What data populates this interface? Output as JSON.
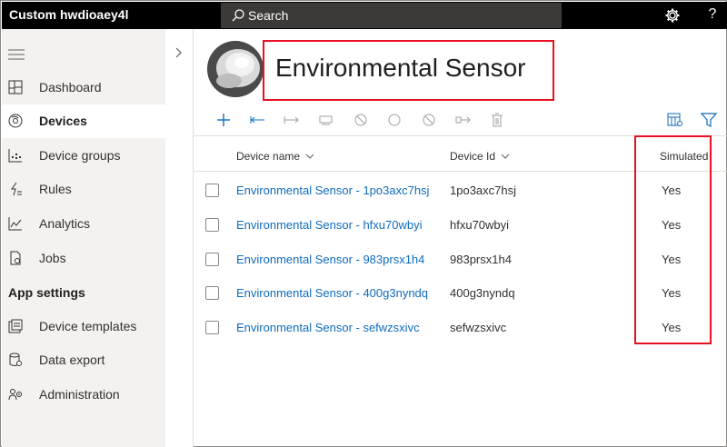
{
  "app": {
    "title": "Custom hwdioaey4l"
  },
  "search": {
    "placeholder": "Search"
  },
  "topbar": {
    "settings_icon": "gear-icon",
    "help_icon": "help-icon",
    "help_glyph": "?"
  },
  "sidebar": {
    "items": [
      {
        "label": "Dashboard",
        "icon": "dashboard-icon",
        "active": false
      },
      {
        "label": "Devices",
        "icon": "devices-icon",
        "active": true
      },
      {
        "label": "Device groups",
        "icon": "device-groups-icon",
        "active": false
      },
      {
        "label": "Rules",
        "icon": "rules-icon",
        "active": false
      },
      {
        "label": "Analytics",
        "icon": "analytics-icon",
        "active": false
      },
      {
        "label": "Jobs",
        "icon": "jobs-icon",
        "active": false
      }
    ],
    "section_label": "App settings",
    "settings_items": [
      {
        "label": "Device templates",
        "icon": "device-templates-icon"
      },
      {
        "label": "Data export",
        "icon": "data-export-icon"
      },
      {
        "label": "Administration",
        "icon": "administration-icon"
      }
    ]
  },
  "header": {
    "title": "Environmental Sensor"
  },
  "toolbar": {
    "icons": [
      "add-icon",
      "connect-icon",
      "disconnect-icon",
      "migrate-icon",
      "block-icon",
      "circle-icon",
      "unblock-icon",
      "export-icon",
      "delete-icon",
      "column-options-icon",
      "filter-icon"
    ]
  },
  "table": {
    "columns": {
      "name": "Device name",
      "id": "Device Id",
      "simulated": "Simulated"
    },
    "rows": [
      {
        "name": "Environmental Sensor - 1po3axc7hsj",
        "id": "1po3axc7hsj",
        "simulated": "Yes"
      },
      {
        "name": "Environmental Sensor - hfxu70wbyi",
        "id": "hfxu70wbyi",
        "simulated": "Yes"
      },
      {
        "name": "Environmental Sensor - 983prsx1h4",
        "id": "983prsx1h4",
        "simulated": "Yes"
      },
      {
        "name": "Environmental Sensor - 400g3nyndq",
        "id": "400g3nyndq",
        "simulated": "Yes"
      },
      {
        "name": "Environmental Sensor - sefwzsxivc",
        "id": "sefwzsxivc",
        "simulated": "Yes"
      }
    ]
  },
  "colors": {
    "accent": "#0f6cbd",
    "highlight": "#e81123",
    "topbar": "#000000",
    "sidebar": "#f3f2f1"
  }
}
